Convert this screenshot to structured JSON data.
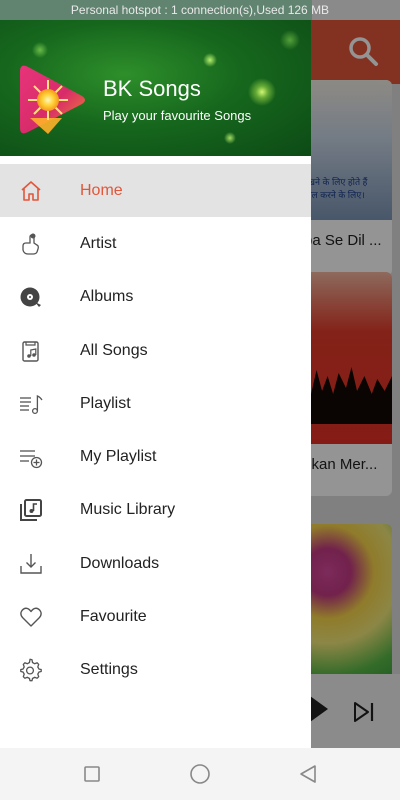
{
  "status_bar": {
    "text": "Personal hotspot : 1 connection(s),Used  126 MB"
  },
  "drawer": {
    "app_name": "BK Songs",
    "tagline": "Play your favourite Songs",
    "items": [
      {
        "label": "Home",
        "icon": "home-icon",
        "active": true
      },
      {
        "label": "Artist",
        "icon": "artist-hand-icon",
        "active": false
      },
      {
        "label": "Albums",
        "icon": "album-disc-icon",
        "active": false
      },
      {
        "label": "All Songs",
        "icon": "song-file-icon",
        "active": false
      },
      {
        "label": "Playlist",
        "icon": "playlist-icon",
        "active": false
      },
      {
        "label": "My Playlist",
        "icon": "playlist-add-icon",
        "active": false
      },
      {
        "label": "Music Library",
        "icon": "music-library-icon",
        "active": false
      },
      {
        "label": "Downloads",
        "icon": "download-icon",
        "active": false
      },
      {
        "label": "Favourite",
        "icon": "heart-icon",
        "active": false
      },
      {
        "label": "Settings",
        "icon": "gear-icon",
        "active": false
      }
    ]
  },
  "background": {
    "cards": [
      {
        "title": "ba Se Dil ...",
        "caption": "रखने के लिए होते हैं\nाल करने के लिए।"
      },
      {
        "title": "skan Mer..."
      },
      {
        "title": ""
      }
    ]
  },
  "colors": {
    "accent": "#e2563a",
    "active_row": "#e3e3e3",
    "header_green": "#16671d"
  }
}
